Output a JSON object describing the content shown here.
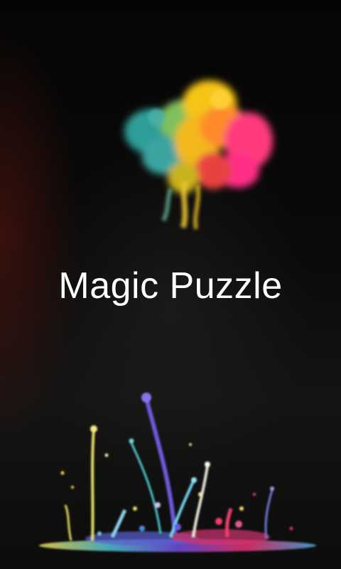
{
  "splash": {
    "title": "Magic Puzzle"
  },
  "art": {
    "smoke_icon": "colorful-smoke-cloud",
    "splash_icon": "paint-splash-droplets"
  },
  "colors": {
    "background": "#000000",
    "title": "#ffffff",
    "teal": "#2f9e98",
    "yellow": "#f2c21d",
    "orange": "#ff8a2a",
    "pink": "#ff2f86"
  }
}
